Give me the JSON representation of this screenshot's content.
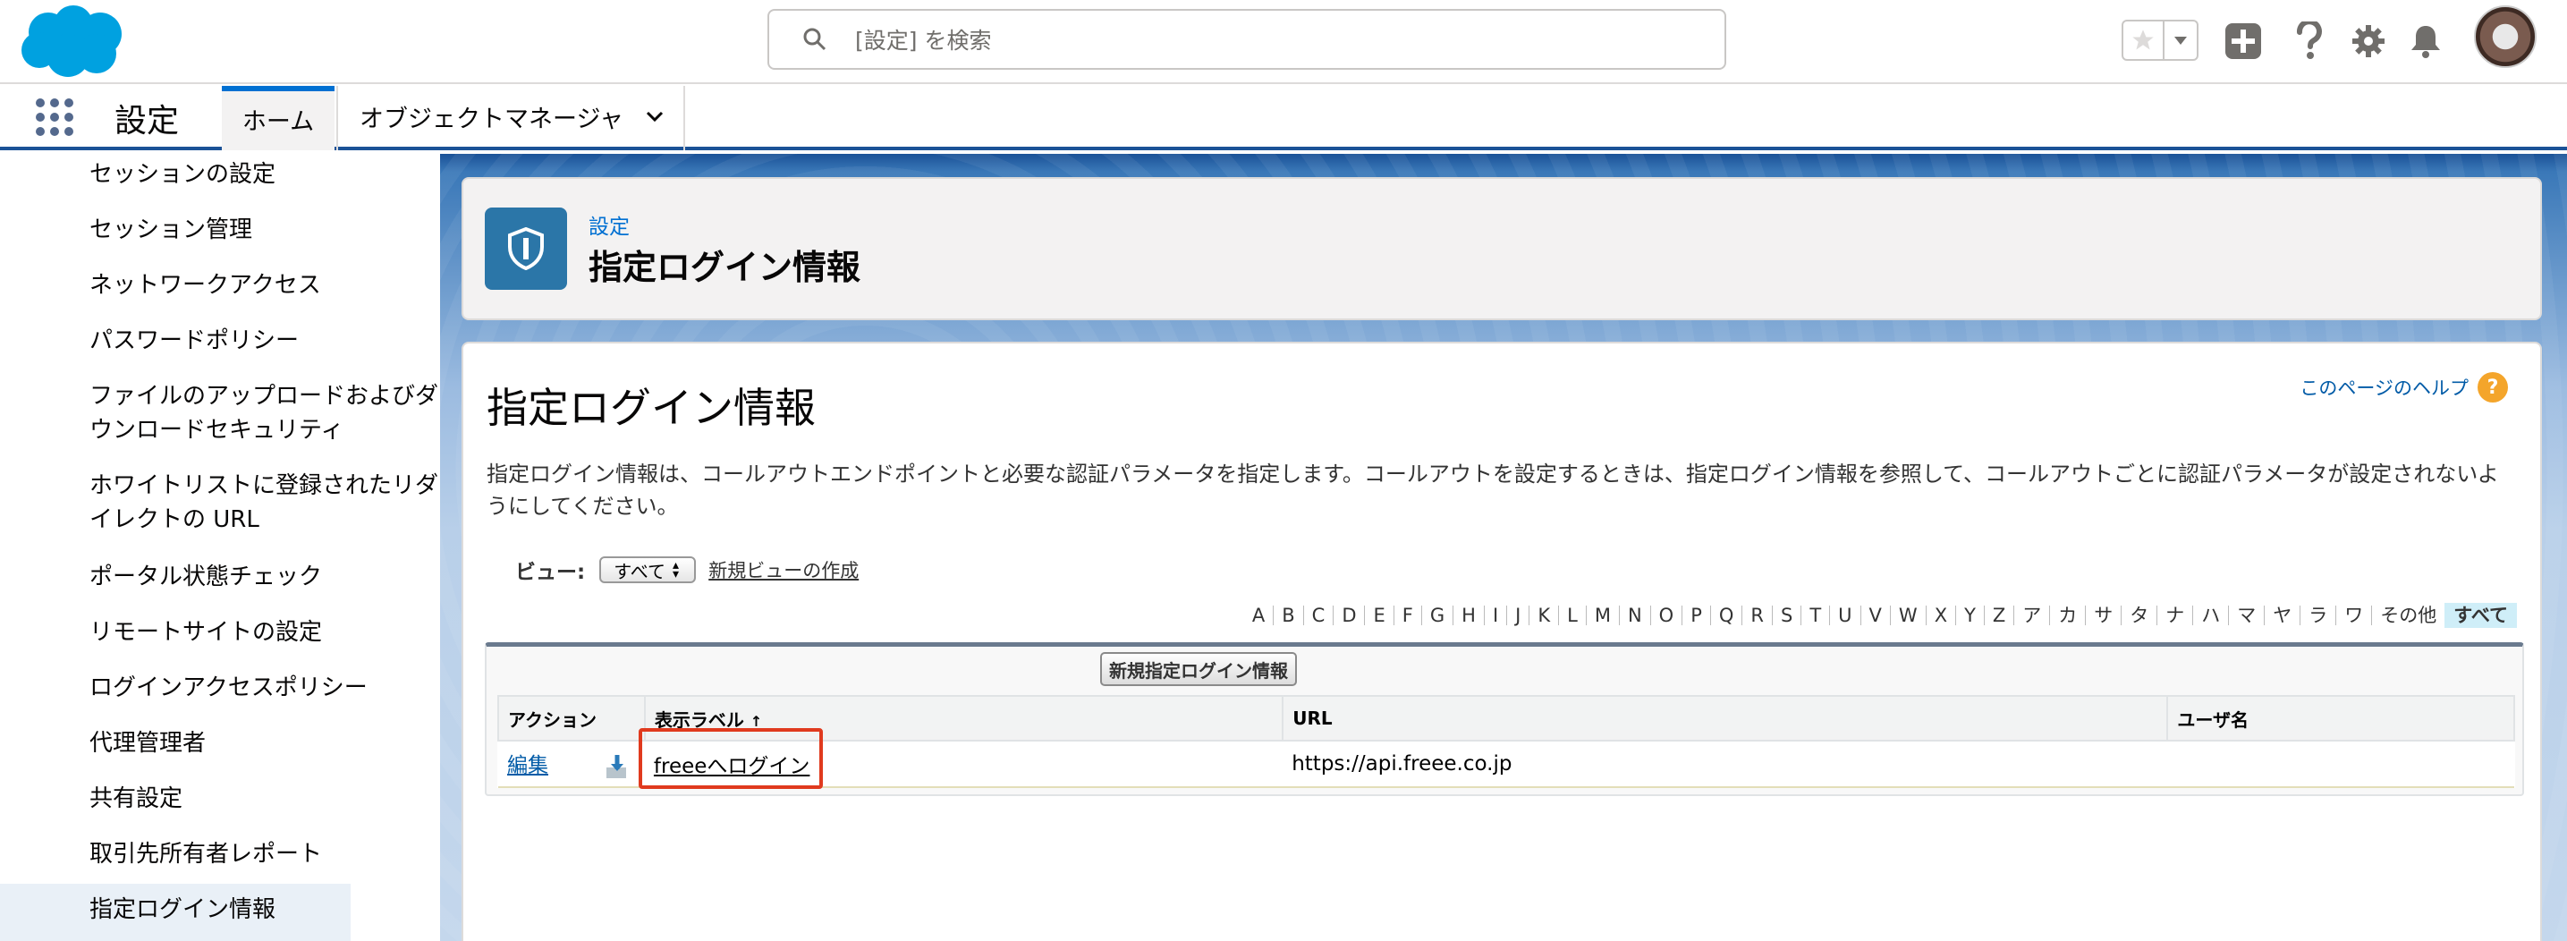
{
  "header": {
    "search_placeholder": "[設定] を検索"
  },
  "nav": {
    "app_name": "設定",
    "tab_home": "ホーム",
    "tab_object_manager": "オブジェクトマネージャ"
  },
  "sidebar": {
    "items": [
      "セッションの設定",
      "セッション管理",
      "ネットワークアクセス",
      "パスワードポリシー",
      "ファイルのアップロードおよびダウンロードセキュリティ",
      "ホワイトリストに登録されたリダイレクトの URL",
      "ポータル状態チェック",
      "リモートサイトの設定",
      "ログインアクセスポリシー",
      "代理管理者",
      "共有設定",
      "取引先所有者レポート",
      "指定ログイン情報"
    ],
    "item_lines": [
      [
        "セッションの設定"
      ],
      [
        "セッション管理"
      ],
      [
        "ネットワークアクセス"
      ],
      [
        "パスワードポリシー"
      ],
      [
        "ファイルのアップロードおよびダ",
        "ウンロードセキュリティ"
      ],
      [
        "ホワイトリストに登録されたリダ",
        "イレクトの URL"
      ],
      [
        "ポータル状態チェック"
      ],
      [
        "リモートサイトの設定"
      ],
      [
        "ログインアクセスポリシー"
      ],
      [
        "代理管理者"
      ],
      [
        "共有設定"
      ],
      [
        "取引先所有者レポート"
      ],
      [
        "指定ログイン情報"
      ]
    ],
    "active_index": 12
  },
  "page_header": {
    "eyebrow": "設定",
    "title": "指定ログイン情報"
  },
  "content": {
    "title": "指定ログイン情報",
    "help_link": "このページのヘルプ",
    "description": "指定ログイン情報は、コールアウトエンドポイントと必要な認証パラメータを指定します。コールアウトを設定するときは、指定ログイン情報を参照して、コールアウトごとに認証パラメータが設定されないようにしてください。",
    "view_label": "ビュー:",
    "view_selected": "すべて",
    "new_view_link": "新規ビューの作成",
    "alphabet": [
      "A",
      "B",
      "C",
      "D",
      "E",
      "F",
      "G",
      "H",
      "I",
      "J",
      "K",
      "L",
      "M",
      "N",
      "O",
      "P",
      "Q",
      "R",
      "S",
      "T",
      "U",
      "V",
      "W",
      "X",
      "Y",
      "Z",
      "ア",
      "カ",
      "サ",
      "タ",
      "ナ",
      "ハ",
      "マ",
      "ヤ",
      "ラ",
      "ワ",
      "その他",
      "すべて"
    ],
    "alphabet_selected": "すべて",
    "new_button": "新規指定ログイン情報",
    "table": {
      "columns": [
        "アクション",
        "表示ラベル",
        "URL",
        "ユーザ名"
      ],
      "sort_indicator": "↑",
      "rows": [
        {
          "action": "編集",
          "label": "freeeへログイン",
          "url": "https://api.freee.co.jp",
          "username": ""
        }
      ]
    }
  },
  "colors": {
    "brand_blue": "#1b5297",
    "link_blue": "#0070d2",
    "highlight_red": "#e03a1e",
    "help_orange": "#f4a52b"
  }
}
